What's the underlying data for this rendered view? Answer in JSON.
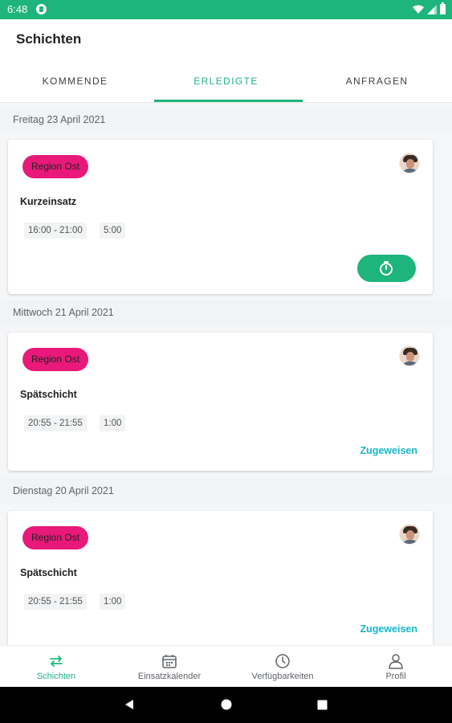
{
  "status": {
    "time": "6:48"
  },
  "header": {
    "title": "Schichten"
  },
  "tabs": [
    {
      "label": "KOMMENDE"
    },
    {
      "label": "ERLEDIGTE"
    },
    {
      "label": "ANFRAGEN"
    }
  ],
  "active_tab": "ERLEDIGTE",
  "days": [
    {
      "date": "Freitag 23 April 2021",
      "region": "Region Ost",
      "shift": "Kurzeinsatz",
      "time_range": "16:00 - 21:00",
      "duration": "5:00",
      "action": "timer"
    },
    {
      "date": "Mittwoch 21 April 2021",
      "region": "Region Ost",
      "shift": "Spätschicht",
      "time_range": "20:55 - 21:55",
      "duration": "1:00",
      "action_label": "Zugeweisen"
    },
    {
      "date": "Dienstag 20 April 2021",
      "region": "Region Ost",
      "shift": "Spätschicht",
      "time_range": "20:55 - 21:55",
      "duration": "1:00",
      "action_label": "Zugeweisen"
    }
  ],
  "bottom_nav": [
    {
      "label": "Schichten",
      "icon": "swap-arrows-icon",
      "active": true
    },
    {
      "label": "Einsatzkalender",
      "icon": "calendar-icon"
    },
    {
      "label": "Verfügbarkeiten",
      "icon": "clock-icon"
    },
    {
      "label": "Profil",
      "icon": "person-icon"
    }
  ],
  "colors": {
    "accent": "#1db57c",
    "region_chip": "#e8197a",
    "link": "#17b8c9"
  }
}
